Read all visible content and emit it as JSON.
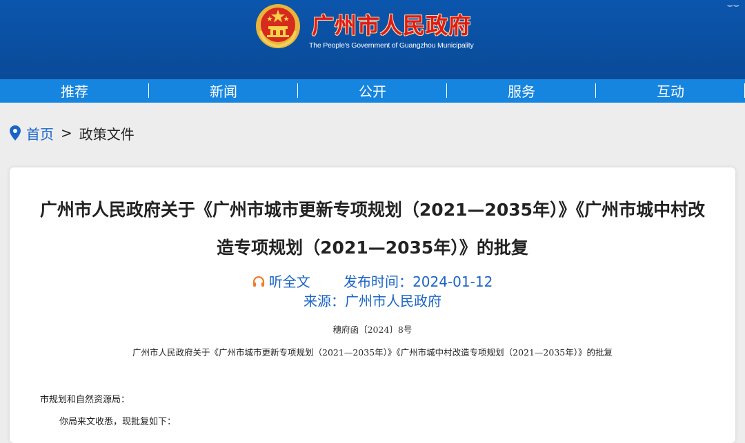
{
  "header": {
    "title": "广州市人民政府",
    "subtitle": "The People's Government of Guangzhou Municipality",
    "bg_color": "#0a4fa0",
    "title_color": "#e01a1a"
  },
  "nav": {
    "items": [
      {
        "label": "推荐"
      },
      {
        "label": "新闻"
      },
      {
        "label": "公开"
      },
      {
        "label": "服务"
      },
      {
        "label": "互动"
      }
    ],
    "bg_color": "#1585e0"
  },
  "breadcrumb": {
    "home": "首页",
    "separator": ">",
    "current": "政策文件"
  },
  "article": {
    "title": "广州市人民政府关于《广州市城市更新专项规划（2021—2035年）》《广州市城中村改造专项规划（2021—2035年）》的批复",
    "listen_label": "听全文",
    "publish_label": "发布时间：",
    "publish_date": "2024-01-12",
    "source_label": "来源：",
    "source": "广州市人民政府",
    "doc_number": "穗府函〔2024〕8号",
    "subtitle": "广州市人民政府关于《广州市城市更新专项规划（2021—2035年）》《广州市城中村改造专项规划（2021—2035年）》的批复",
    "recipient": "市规划和自然资源局：",
    "body": "你局来文收悉，现批复如下："
  }
}
